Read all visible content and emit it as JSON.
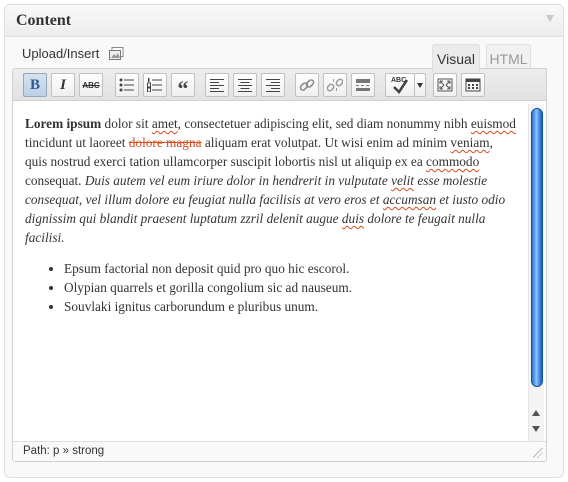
{
  "postbox": {
    "title": "Content"
  },
  "media": {
    "upload_label": "Upload/Insert"
  },
  "tabs": {
    "visual": "Visual",
    "html": "HTML"
  },
  "toolbar": {
    "bold_label": "B",
    "italic_label": "I",
    "strike_label": "ABC",
    "blockquote_label": "“",
    "spellcheck_label": "ABC",
    "buttons": [
      "bold",
      "italic",
      "strikethrough",
      "bulleted-list",
      "numbered-list",
      "blockquote",
      "align-left",
      "align-center",
      "align-right",
      "insert-link",
      "unlink",
      "insert-more-tag",
      "spellcheck",
      "spellcheck-dropdown",
      "fullscreen",
      "kitchen-sink"
    ]
  },
  "content": {
    "p1": {
      "bold": "Lorem ipsum",
      "t1": " dolor sit ",
      "s1": "amet",
      "t2": ", consectetuer adipiscing elit, sed diam nonummy nibh ",
      "s2": "euismod",
      "t3": " tincidunt ut laoreet ",
      "strike": "dolore magna",
      "t4": " aliquam erat volutpat. Ut wisi enim ad minim ",
      "s3": "veniam",
      "t5": ", quis nostrud exerci tation ullamcorper suscipit lobortis nisl ut aliquip ex ea ",
      "s4": "commodo",
      "t6": " consequat. ",
      "i1": "Duis autem vel eum iriure dolor in hendrerit in vulputate ",
      "is1": "velit",
      "i2": " esse molestie consequat, vel illum dolore eu feugiat nulla facilisis at vero eros et ",
      "is2": "accumsan",
      "i3": " et iusto odio dignissim qui blandit praesent luptatum zzril delenit augue ",
      "is3": "duis",
      "i4": " dolore te feugait nulla facilisi."
    },
    "list": [
      "Epsum factorial non deposit quid pro quo hic escorol.",
      "Olypian quarrels et gorilla congolium sic ad nauseum.",
      "Souvlaki ignitus carborundum e pluribus unum."
    ]
  },
  "path_bar": {
    "text": "Path: p » strong"
  },
  "colors": {
    "spell_error": "#d54e21",
    "scroll_thumb": "#4a90e6"
  }
}
